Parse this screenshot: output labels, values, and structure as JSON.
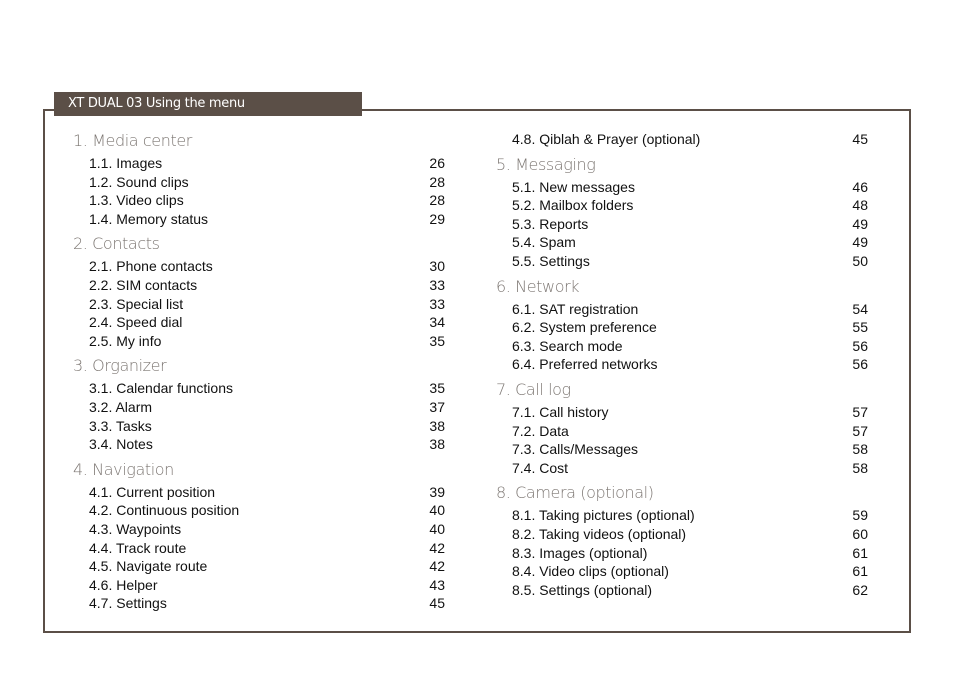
{
  "header": {
    "title": "XT DUAL 03 Using the menu"
  },
  "colors": {
    "accent": "#5b4f47",
    "section_title": "#7d7773",
    "text": "#111111"
  },
  "left_column": [
    {
      "title": "1. Media center",
      "items": [
        {
          "label": "1.1. Images",
          "page": "26"
        },
        {
          "label": "1.2. Sound clips",
          "page": "28"
        },
        {
          "label": "1.3. Video clips",
          "page": "28"
        },
        {
          "label": "1.4. Memory status",
          "page": "29"
        }
      ]
    },
    {
      "title": "2. Contacts",
      "items": [
        {
          "label": "2.1. Phone contacts",
          "page": "30"
        },
        {
          "label": "2.2. SIM contacts",
          "page": "33"
        },
        {
          "label": "2.3. Special list",
          "page": "33"
        },
        {
          "label": "2.4. Speed dial",
          "page": "34"
        },
        {
          "label": "2.5. My info",
          "page": "35"
        }
      ]
    },
    {
      "title": "3. Organizer",
      "items": [
        {
          "label": "3.1. Calendar functions",
          "page": "35"
        },
        {
          "label": "3.2. Alarm",
          "page": "37"
        },
        {
          "label": "3.3. Tasks",
          "page": "38"
        },
        {
          "label": "3.4. Notes",
          "page": "38"
        }
      ]
    },
    {
      "title": "4. Navigation",
      "items": [
        {
          "label": "4.1. Current position",
          "page": "39"
        },
        {
          "label": "4.2. Continuous position",
          "page": "40"
        },
        {
          "label": "4.3. Waypoints",
          "page": "40"
        },
        {
          "label": "4.4. Track route",
          "page": "42"
        },
        {
          "label": "4.5. Navigate route",
          "page": "42"
        },
        {
          "label": "4.6. Helper",
          "page": "43"
        },
        {
          "label": "4.7. Settings",
          "page": "45"
        }
      ]
    }
  ],
  "right_column": {
    "continued_items": [
      {
        "label": "4.8. Qiblah & Prayer (optional)",
        "page": "45"
      }
    ],
    "sections": [
      {
        "title": "5. Messaging",
        "items": [
          {
            "label": "5.1. New messages",
            "page": "46"
          },
          {
            "label": "5.2. Mailbox folders",
            "page": "48"
          },
          {
            "label": "5.3. Reports",
            "page": "49"
          },
          {
            "label": "5.4. Spam",
            "page": "49"
          },
          {
            "label": "5.5. Settings",
            "page": "50"
          }
        ]
      },
      {
        "title": "6. Network",
        "items": [
          {
            "label": "6.1. SAT registration",
            "page": "54"
          },
          {
            "label": "6.2. System preference",
            "page": "55"
          },
          {
            "label": "6.3. Search mode",
            "page": "56"
          },
          {
            "label": "6.4. Preferred networks",
            "page": "56"
          }
        ]
      },
      {
        "title": "7. Call log",
        "items": [
          {
            "label": "7.1. Call history",
            "page": "57"
          },
          {
            "label": "7.2. Data",
            "page": "57"
          },
          {
            "label": "7.3. Calls/Messages",
            "page": "58"
          },
          {
            "label": "7.4. Cost",
            "page": "58"
          }
        ]
      },
      {
        "title": "8. Camera (optional)",
        "items": [
          {
            "label": "8.1. Taking pictures (optional)",
            "page": "59"
          },
          {
            "label": "8.2. Taking videos (optional)",
            "page": "60"
          },
          {
            "label": "8.3. Images (optional)",
            "page": "61"
          },
          {
            "label": "8.4. Video clips (optional)",
            "page": "61"
          },
          {
            "label": "8.5. Settings (optional)",
            "page": "62"
          }
        ]
      }
    ]
  }
}
